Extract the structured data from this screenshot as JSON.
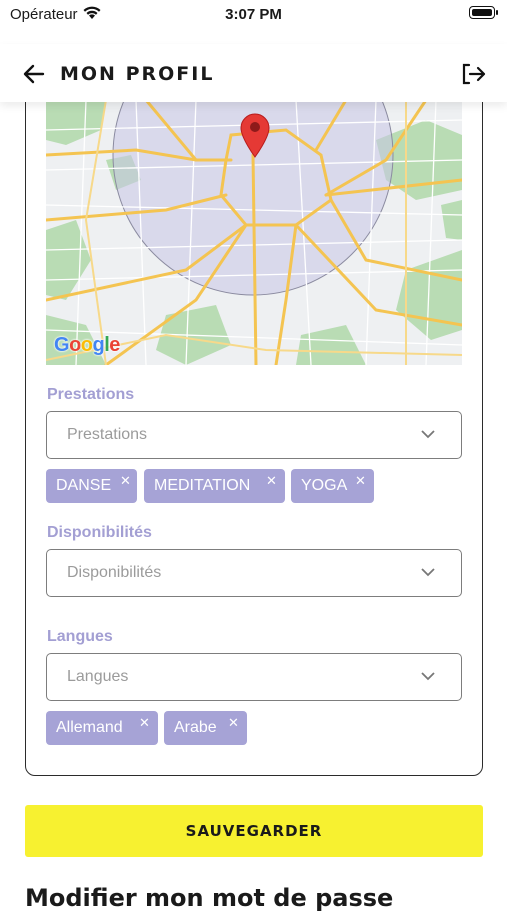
{
  "status_bar": {
    "carrier": "Opérateur",
    "time": "3:07 PM"
  },
  "header": {
    "title": "MON PROFIL"
  },
  "map": {
    "attribution": "Google"
  },
  "prestations": {
    "label": "Prestations",
    "placeholder": "Prestations",
    "chips": [
      "DANSE",
      "MEDITATION",
      "YOGA"
    ]
  },
  "disponibilites": {
    "label": "Disponibilités",
    "placeholder": "Disponibilités"
  },
  "langues": {
    "label": "Langues",
    "placeholder": "Langues",
    "chips": [
      "Allemand",
      "Arabe"
    ]
  },
  "save_button": "SAUVEGARDER",
  "password_section": {
    "heading": "Modifier mon mot de passe"
  },
  "colors": {
    "accent_yellow": "#f7f130",
    "chip_purple": "#a6a3d6",
    "label_purple": "#a39fd3"
  }
}
